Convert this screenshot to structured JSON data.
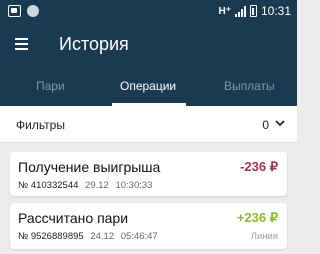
{
  "status_bar": {
    "network": "H⁺",
    "time": "10:31"
  },
  "app_bar": {
    "title": "История",
    "menu_icon": "hamburger-menu-icon"
  },
  "tabs": [
    {
      "label": "Пари",
      "active": false
    },
    {
      "label": "Операции",
      "active": true
    },
    {
      "label": "Выплаты",
      "active": false
    }
  ],
  "filters": {
    "label": "Фильтры",
    "count": "0"
  },
  "operations": [
    {
      "title": "Получение выигрыша",
      "amount": "-236 ₽",
      "amount_color": "#a3364f",
      "number": "№ 410332544",
      "date": "29.12",
      "time": "10:30:33"
    },
    {
      "title": "Рассчитано пари",
      "amount": "+236 ₽",
      "amount_color": "#8fb82a",
      "number": "№ 9526889895",
      "date": "24.12",
      "time": "05:46:47",
      "type": "Линия"
    }
  ],
  "colors": {
    "header_bg": "#1a3a52",
    "tab_inactive": "#7f95a6",
    "page_bg": "#ececec"
  }
}
